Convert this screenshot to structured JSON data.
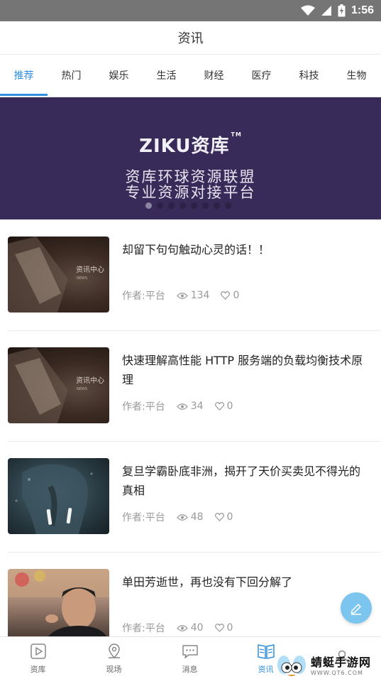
{
  "status_bar": {
    "time": "1:56"
  },
  "header": {
    "title": "资讯"
  },
  "tabs": [
    {
      "label": "推荐",
      "active": true
    },
    {
      "label": "热门"
    },
    {
      "label": "娱乐"
    },
    {
      "label": "生活"
    },
    {
      "label": "财经"
    },
    {
      "label": "医疗"
    },
    {
      "label": "科技"
    },
    {
      "label": "生物"
    }
  ],
  "banner": {
    "logo": "ZIKU资库",
    "trademark": "TM",
    "line1": "资库环球资源联盟",
    "line2": "专业资源对接平台",
    "page_count": 8,
    "active_index": 0
  },
  "articles": [
    {
      "title": "却留下句句触动心灵的话！！",
      "author": "作者:平台",
      "views": "134",
      "likes": "0",
      "thumb_icon": "news-center-image",
      "thumb_caption": "资讯中心",
      "thumb_sub": "NEWS"
    },
    {
      "title": "快速理解高性能 HTTP 服务端的负载均衡技术原理",
      "author": "作者:平台",
      "views": "34",
      "likes": "0",
      "thumb_icon": "news-center-image",
      "thumb_caption": "资讯中心",
      "thumb_sub": "NEWS"
    },
    {
      "title": "复旦学霸卧底非洲，揭开了天价买卖见不得光的真相",
      "author": "作者:平台",
      "views": "48",
      "likes": "0",
      "thumb_icon": "elephant-image"
    },
    {
      "title": "单田芳逝世，再也没有下回分解了",
      "author": "作者:平台",
      "views": "40",
      "likes": "0",
      "thumb_icon": "person-portrait-image"
    }
  ],
  "bottom_nav": [
    {
      "label": "资库",
      "icon": "play-square-icon"
    },
    {
      "label": "现场",
      "icon": "location-pin-icon"
    },
    {
      "label": "消息",
      "icon": "chat-bubble-icon"
    },
    {
      "label": "资讯",
      "icon": "open-book-icon",
      "active": true
    },
    {
      "label": "",
      "icon": "user-icon"
    }
  ],
  "watermark": {
    "title": "蜻蜓手游网",
    "url": "WWW.QT6.COM"
  },
  "colors": {
    "accent": "#2f8ee0",
    "banner_bg": "#382b5a",
    "status_bar": "#757575",
    "fab": "#7cc5ee"
  }
}
